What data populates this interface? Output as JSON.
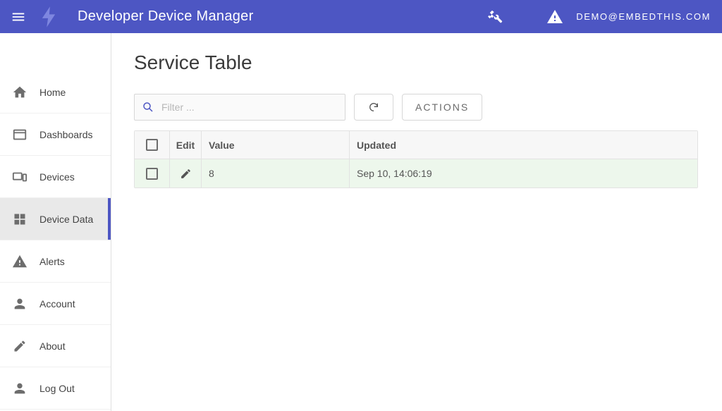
{
  "header": {
    "app_title": "Developer Device Manager",
    "user_email": "DEMO@EMBEDTHIS.COM"
  },
  "sidebar": {
    "items": [
      {
        "label": "Home",
        "icon": "home-icon"
      },
      {
        "label": "Dashboards",
        "icon": "dashboard-icon"
      },
      {
        "label": "Devices",
        "icon": "devices-icon"
      },
      {
        "label": "Device Data",
        "icon": "grid-icon",
        "active": true
      },
      {
        "label": "Alerts",
        "icon": "warning-icon"
      },
      {
        "label": "Account",
        "icon": "person-icon"
      },
      {
        "label": "About",
        "icon": "pencil-icon"
      },
      {
        "label": "Log Out",
        "icon": "person-icon"
      }
    ]
  },
  "page": {
    "title": "Service Table",
    "filter_placeholder": "Filter ...",
    "actions_label": "ACTIONS"
  },
  "table": {
    "columns": {
      "edit": "Edit",
      "value": "Value",
      "updated": "Updated"
    },
    "rows": [
      {
        "value": "8",
        "updated": "Sep 10, 14:06:19"
      }
    ]
  }
}
